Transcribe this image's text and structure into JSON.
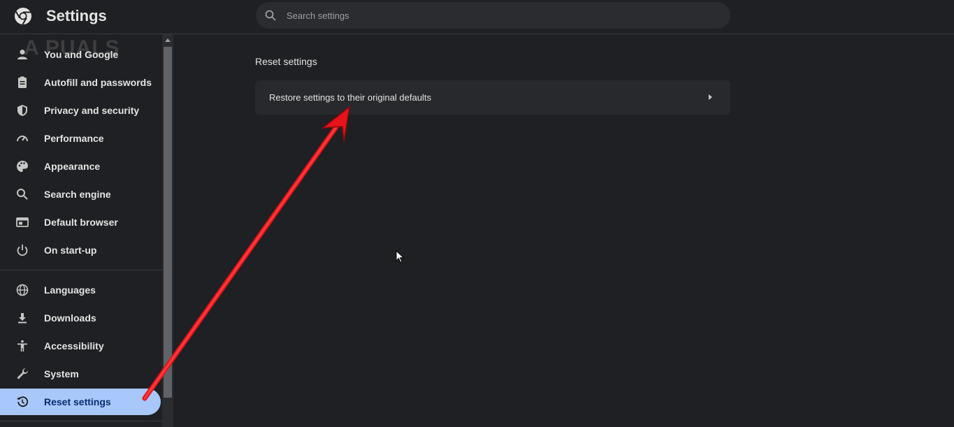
{
  "header": {
    "title": "Settings",
    "search_placeholder": "Search settings"
  },
  "watermark": "A  PUALS",
  "sidebar": {
    "items": [
      {
        "label": "You and Google",
        "icon": "person-icon"
      },
      {
        "label": "Autofill and passwords",
        "icon": "clipboard-icon"
      },
      {
        "label": "Privacy and security",
        "icon": "shield-icon"
      },
      {
        "label": "Performance",
        "icon": "speedometer-icon"
      },
      {
        "label": "Appearance",
        "icon": "palette-icon"
      },
      {
        "label": "Search engine",
        "icon": "search-icon"
      },
      {
        "label": "Default browser",
        "icon": "browser-window-icon"
      },
      {
        "label": "On start-up",
        "icon": "power-icon"
      },
      {
        "label": "Languages",
        "icon": "globe-icon"
      },
      {
        "label": "Downloads",
        "icon": "download-icon"
      },
      {
        "label": "Accessibility",
        "icon": "accessibility-icon"
      },
      {
        "label": "System",
        "icon": "wrench-icon"
      },
      {
        "label": "Reset settings",
        "icon": "history-icon",
        "active": true
      }
    ]
  },
  "main": {
    "section_title": "Reset settings",
    "restore_label": "Restore settings to their original defaults"
  },
  "colors": {
    "background": "#1f2023",
    "active_item": "#a8c7fa",
    "annotation_arrow": "#e8121a"
  }
}
